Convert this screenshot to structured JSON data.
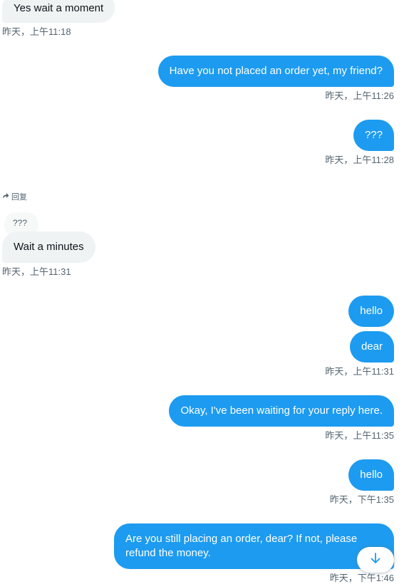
{
  "messages": {
    "m1": {
      "text": "Yes wait a moment",
      "time": "昨天，上午11:18"
    },
    "m2": {
      "text": "Have you not placed an order yet, my friend?",
      "time": "昨天，上午11:26"
    },
    "m3": {
      "text": "???",
      "time": "昨天，上午11:28"
    },
    "reply": {
      "label": "回复",
      "quoted": "???",
      "text": "Wait a minutes",
      "time": "昨天，上午11:31"
    },
    "m5": {
      "text": "hello"
    },
    "m6": {
      "text": "dear",
      "time": "昨天，上午11:31"
    },
    "m7": {
      "text": "Okay, I've been waiting for your reply here.",
      "time": "昨天，上午11:35"
    },
    "m8": {
      "text": "hello",
      "time": "昨天，下午1:35"
    },
    "m9": {
      "line1": "Are you still placing an order, dear? If not, please",
      "line2": "refund the money.",
      "time": "昨天，下午1:46"
    }
  },
  "colors": {
    "outgoing": "#1d9bf0",
    "incoming": "#eff3f4",
    "timestamp": "#536471"
  },
  "icons": {
    "reply": "reply-arrow-icon",
    "scroll_down": "arrow-down-icon"
  }
}
